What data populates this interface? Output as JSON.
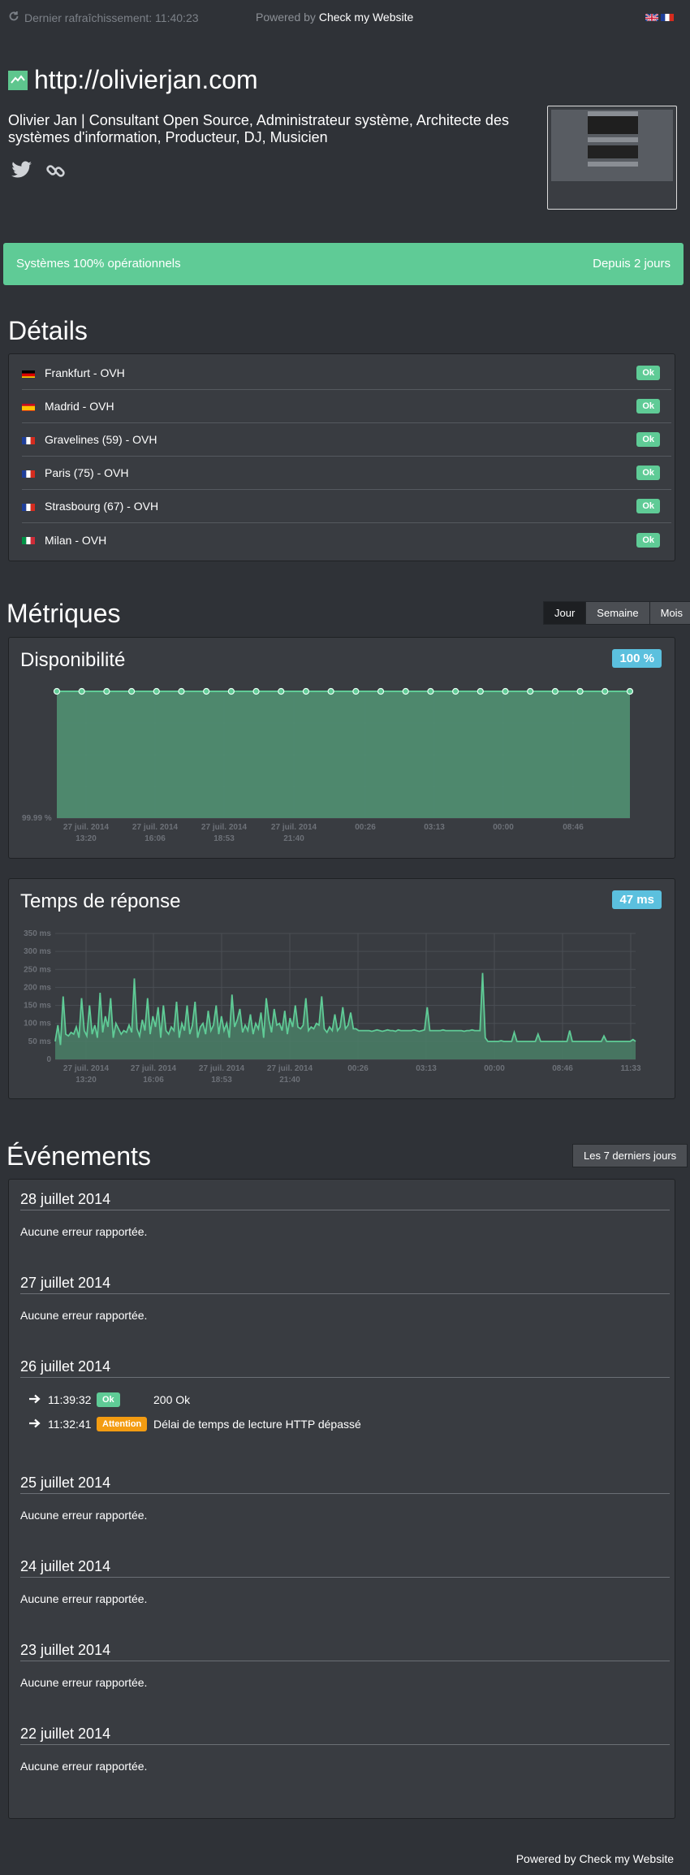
{
  "topbar": {
    "refresh_icon": "refresh-icon",
    "last_refresh": "Dernier rafraîchissement: 11:40:23",
    "powered_prefix": "Powered by",
    "powered_brand": "Check my Website",
    "languages": [
      "en",
      "fr"
    ]
  },
  "site": {
    "url": "http://olivierjan.com",
    "description": "Olivier Jan | Consultant Open Source, Administrateur système, Architecte des systèmes d'information, Producteur, DJ, Musicien",
    "social_icons": [
      "twitter-icon",
      "link-icon"
    ]
  },
  "status": {
    "text": "Systèmes 100% opérationnels",
    "since": "Depuis 2 jours",
    "color": "#5fcb96"
  },
  "details": {
    "title": "Détails",
    "locations": [
      {
        "name": "Frankfurt - OVH",
        "flag": "de",
        "status": "Ok"
      },
      {
        "name": "Madrid - OVH",
        "flag": "es",
        "status": "Ok"
      },
      {
        "name": "Gravelines (59) - OVH",
        "flag": "fr",
        "status": "Ok"
      },
      {
        "name": "Paris (75) - OVH",
        "flag": "fr",
        "status": "Ok"
      },
      {
        "name": "Strasbourg (67) - OVH",
        "flag": "fr",
        "status": "Ok"
      },
      {
        "name": "Milan - OVH",
        "flag": "it",
        "status": "Ok"
      }
    ]
  },
  "metrics": {
    "title": "Métriques",
    "ranges": [
      "Jour",
      "Semaine",
      "Mois"
    ],
    "active_range": "Jour"
  },
  "chart_data": [
    {
      "type": "area",
      "title": "Disponibilité",
      "badge": "100 %",
      "ylabel_min": "99.99 %",
      "ylim": [
        99.99,
        100
      ],
      "x_tick_labels": [
        [
          "27 juil. 2014",
          "13:20"
        ],
        [
          "27 juil. 2014",
          "16:06"
        ],
        [
          "27 juil. 2014",
          "18:53"
        ],
        [
          "27 juil. 2014",
          "21:40"
        ],
        [
          "00:26",
          ""
        ],
        [
          "03:13",
          ""
        ],
        [
          "00:00",
          ""
        ],
        [
          "08:46",
          ""
        ]
      ],
      "values": [
        100,
        100,
        100,
        100,
        100,
        100,
        100,
        100,
        100,
        100,
        100,
        100,
        100,
        100,
        100,
        100,
        100,
        100,
        100,
        100,
        100,
        100,
        100,
        100
      ],
      "color": "#5fcb96"
    },
    {
      "type": "area",
      "title": "Temps de réponse",
      "badge": "47 ms",
      "y_tick_labels": [
        "350 ms",
        "300 ms",
        "250 ms",
        "200 ms",
        "150 ms",
        "100 ms",
        "50 ms",
        "0"
      ],
      "y_ticks": [
        350,
        300,
        250,
        200,
        150,
        100,
        50,
        0
      ],
      "ylim": [
        0,
        350
      ],
      "x_tick_labels": [
        [
          "27 juil. 2014",
          "13:20"
        ],
        [
          "27 juil. 2014",
          "16:06"
        ],
        [
          "27 juil. 2014",
          "18:53"
        ],
        [
          "27 juil. 2014",
          "21:40"
        ],
        [
          "00:26",
          ""
        ],
        [
          "03:13",
          ""
        ],
        [
          "00:00",
          ""
        ],
        [
          "08:46",
          ""
        ],
        [
          "11:33",
          ""
        ]
      ],
      "values": [
        50,
        95,
        40,
        175,
        70,
        65,
        75,
        70,
        90,
        60,
        170,
        80,
        65,
        150,
        70,
        95,
        60,
        185,
        75,
        120,
        90,
        170,
        60,
        100,
        85,
        70,
        80,
        75,
        95,
        75,
        225,
        85,
        65,
        110,
        80,
        170,
        70,
        120,
        90,
        145,
        60,
        150,
        80,
        70,
        90,
        80,
        160,
        60,
        100,
        80,
        150,
        70,
        95,
        160,
        60,
        90,
        100,
        70,
        135,
        80,
        95,
        150,
        70,
        120,
        80,
        100,
        60,
        180,
        90,
        110,
        140,
        75,
        95,
        80,
        125,
        70,
        100,
        85,
        130,
        60,
        170,
        110,
        75,
        140,
        95,
        100,
        80,
        135,
        70,
        115,
        90,
        150,
        90,
        85,
        95,
        170,
        80,
        90,
        85,
        100,
        95,
        175,
        85,
        75,
        90,
        80,
        125,
        80,
        90,
        145,
        85,
        95,
        130,
        85,
        85,
        80,
        80,
        80,
        80,
        80,
        78,
        80,
        82,
        80,
        78,
        80,
        82,
        80,
        80,
        78,
        82,
        80,
        80,
        80,
        80,
        80,
        82,
        80,
        78,
        80,
        82,
        145,
        80,
        80,
        80,
        80,
        80,
        82,
        80,
        80,
        80,
        80,
        80,
        80,
        80,
        78,
        80,
        80,
        82,
        80,
        80,
        80,
        240,
        60,
        50,
        50,
        50,
        50,
        50,
        52,
        50,
        50,
        50,
        50,
        75,
        50,
        50,
        50,
        50,
        50,
        50,
        50,
        50,
        70,
        50,
        50,
        50,
        50,
        50,
        50,
        50,
        50,
        50,
        50,
        50,
        80,
        50,
        50,
        50,
        50,
        50,
        50,
        50,
        50,
        50,
        50,
        50,
        50,
        65,
        50,
        50,
        50,
        50,
        50,
        50,
        50,
        50,
        50,
        50,
        55,
        50
      ],
      "color": "#5fcb96"
    }
  ],
  "events": {
    "title": "Événements",
    "range_button": "Les 7 derniers jours",
    "days": [
      {
        "date": "28 juillet 2014",
        "empty_text": "Aucune erreur rapportée."
      },
      {
        "date": "27 juillet 2014",
        "empty_text": "Aucune erreur rapportée."
      },
      {
        "date": "26 juillet 2014",
        "entries": [
          {
            "time": "11:39:32",
            "level": "Ok",
            "message": "200 Ok"
          },
          {
            "time": "11:32:41",
            "level": "Attention",
            "message": "Délai de temps de lecture HTTP dépassé"
          }
        ]
      },
      {
        "date": "25 juillet 2014",
        "empty_text": "Aucune erreur rapportée."
      },
      {
        "date": "24 juillet 2014",
        "empty_text": "Aucune erreur rapportée."
      },
      {
        "date": "23 juillet 2014",
        "empty_text": "Aucune erreur rapportée."
      },
      {
        "date": "22 juillet 2014",
        "empty_text": "Aucune erreur rapportée."
      }
    ]
  },
  "footer": {
    "powered_prefix": "Powered by",
    "powered_brand": "Check my Website"
  }
}
